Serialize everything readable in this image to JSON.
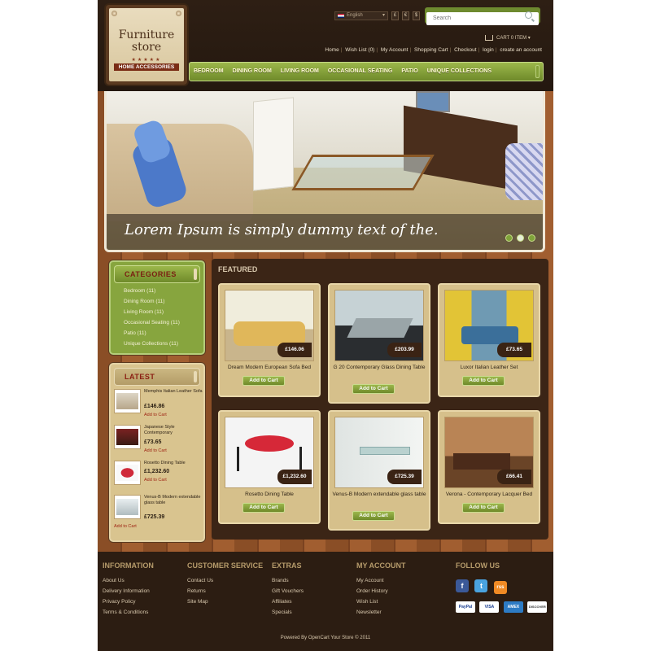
{
  "header": {
    "logo": {
      "title_line1": "Furniture",
      "title_line2": "store",
      "stars": "★★★★★",
      "subtitle": "HOME ACCESSORIES"
    },
    "language": "English",
    "currencies": [
      "£",
      "€",
      "$"
    ],
    "search_placeholder": "Search",
    "cart": "CART 0 ITEM",
    "top_links": [
      "Home",
      "Wish List (0)",
      "My Account",
      "Shopping Cart",
      "Checkout",
      "login",
      "create an account"
    ],
    "menu": [
      "BEDROOM",
      "DINING ROOM",
      "LIVING ROOM",
      "OCCASIONAL SEATING",
      "PATIO",
      "UNIQUE COLLECTIONS"
    ]
  },
  "slider": {
    "caption": "Lorem Ipsum is simply dummy text of the.",
    "active_dot": 2,
    "dot_count": 3
  },
  "categories": {
    "title": "CATEGORIES",
    "items": [
      "Bedroom (11)",
      "Dining Room (11)",
      "Living Room (11)",
      "Occasional Seating (11)",
      "Patio (11)",
      "Unique Collections (11)"
    ]
  },
  "latest": {
    "title": "LATEST",
    "items": [
      {
        "name": "Memphis Italian Leather Sofa",
        "price": "£146.86",
        "add": "Add to Cart"
      },
      {
        "name": "Japanese Style Contemporary",
        "price": "£73.65",
        "add": "Add to Cart"
      },
      {
        "name": "Rosetto Dining Table",
        "price": "£1,232.60",
        "add": "Add to Cart"
      },
      {
        "name": "Venus-B Modern extendable glass table",
        "price": "£725.39",
        "add": "Add to Cart"
      }
    ]
  },
  "featured": {
    "title": "FEATURED",
    "button_label": "Add to Cart",
    "products": [
      {
        "name": "Dream Modern European Sofa Bed",
        "price": "£146.06"
      },
      {
        "name": "G 20 Contemporary Glass Dining Table",
        "price": "£203.99"
      },
      {
        "name": "Luxor Italian Leather Set",
        "price": "£73.65"
      },
      {
        "name": "Rosetto Dining Table",
        "price": "£1,232.60"
      },
      {
        "name": "Venus-B Modern extendable glass table",
        "price": "£725.39"
      },
      {
        "name": "Verona - Contemporary Lacquer Bed",
        "price": "£66.41"
      }
    ]
  },
  "footer": {
    "columns": [
      {
        "title": "INFORMATION",
        "links": [
          "About Us",
          "Delivery Information",
          "Privacy Policy",
          "Terms & Conditions"
        ]
      },
      {
        "title": "CUSTOMER SERVICE",
        "links": [
          "Contact Us",
          "Returns",
          "Site Map"
        ]
      },
      {
        "title": "EXTRAS",
        "links": [
          "Brands",
          "Gift Vouchers",
          "Affiliates",
          "Specials"
        ]
      },
      {
        "title": "MY ACCOUNT",
        "links": [
          "My Account",
          "Order History",
          "Wish List",
          "Newsletter"
        ]
      }
    ],
    "follow_title": "FOLLOW US",
    "social": [
      "f",
      "t",
      "rss"
    ],
    "payments": [
      "PayPal",
      "VISA",
      "AMEX",
      "DISCOVER"
    ],
    "powered": "Powered By OpenCart Your Store © 2011"
  },
  "colors": {
    "accent_green": "#87a53e",
    "dark_brown": "#2c1d12",
    "price_red": "#9c1f10"
  }
}
